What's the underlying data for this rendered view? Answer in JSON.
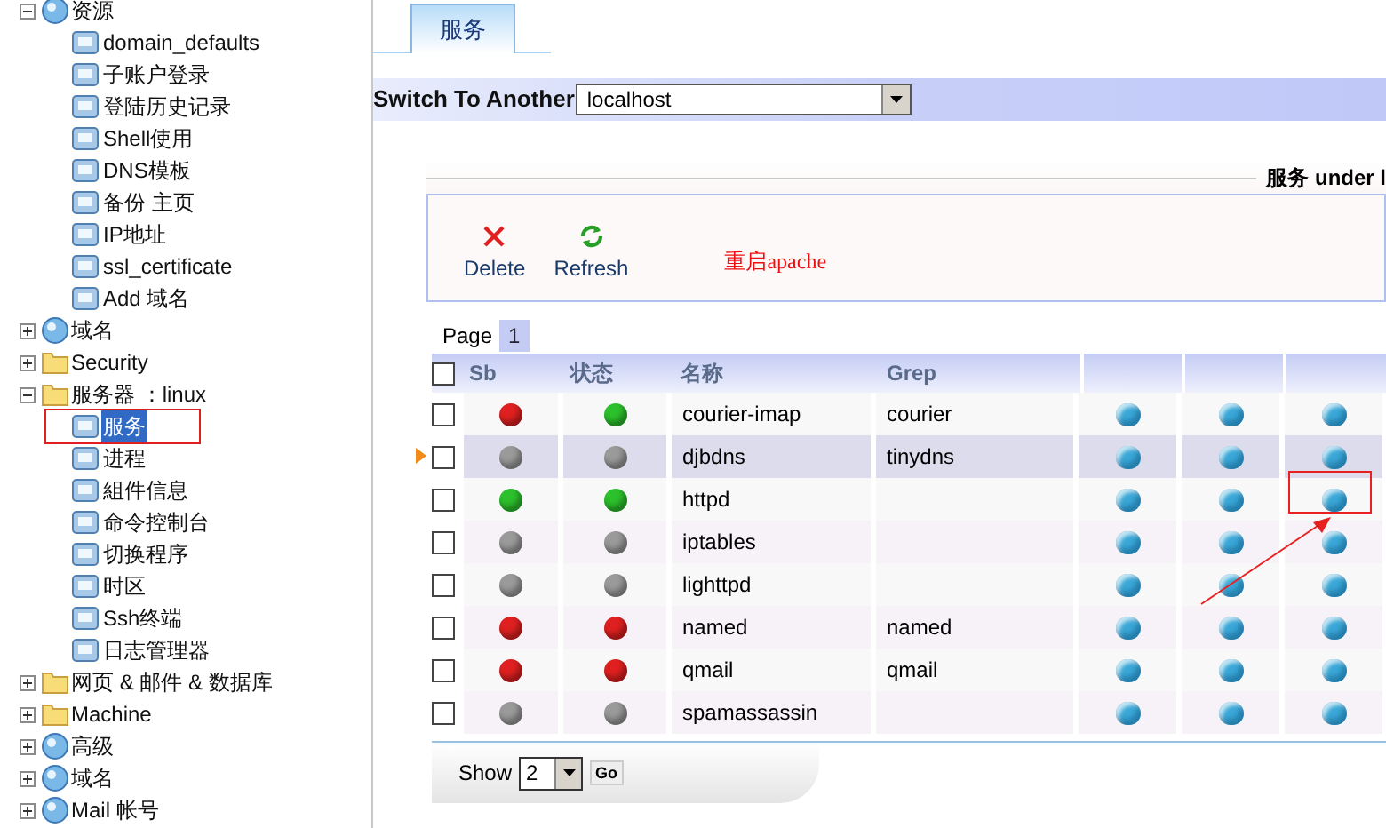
{
  "sidebar": {
    "items": [
      {
        "label": "资源",
        "kind": "item",
        "expanded": true,
        "children": [
          {
            "label": "domain_defaults",
            "selected": false,
            "highlighted": false
          },
          {
            "label": "子账户登录",
            "selected": false,
            "highlighted": false
          },
          {
            "label": "登陆历史记录",
            "selected": false,
            "highlighted": false
          },
          {
            "label": "Shell使用",
            "selected": false,
            "highlighted": false
          },
          {
            "label": "DNS模板",
            "selected": false,
            "highlighted": false
          },
          {
            "label": "备份 主页",
            "selected": false,
            "highlighted": false
          },
          {
            "label": "IP地址",
            "selected": false,
            "highlighted": false
          },
          {
            "label": "ssl_certificate",
            "selected": false,
            "highlighted": false
          },
          {
            "label": "Add 域名",
            "selected": false,
            "highlighted": false
          }
        ]
      },
      {
        "label": "域名",
        "kind": "item",
        "expanded": false
      },
      {
        "label": "Security",
        "kind": "folder",
        "expanded": false
      },
      {
        "label": "服务器 ：linux",
        "kind": "folder",
        "expanded": true,
        "children": [
          {
            "label": "服务",
            "selected": true,
            "highlighted": true
          },
          {
            "label": "进程",
            "selected": false,
            "highlighted": false
          },
          {
            "label": "組件信息",
            "selected": false,
            "highlighted": false
          },
          {
            "label": "命令控制台",
            "selected": false,
            "highlighted": false
          },
          {
            "label": "切换程序",
            "selected": false,
            "highlighted": false
          },
          {
            "label": "时区",
            "selected": false,
            "highlighted": false
          },
          {
            "label": "Ssh终端",
            "selected": false,
            "highlighted": false
          },
          {
            "label": "日志管理器",
            "selected": false,
            "highlighted": false
          }
        ]
      },
      {
        "label": "网页 & 邮件 & 数据库",
        "kind": "folder",
        "expanded": false
      },
      {
        "label": "Machine",
        "kind": "folder",
        "expanded": false
      },
      {
        "label": "高级",
        "kind": "item",
        "expanded": false
      },
      {
        "label": "域名",
        "kind": "item",
        "expanded": false
      },
      {
        "label": "Mail 帐号",
        "kind": "item",
        "expanded": false
      }
    ]
  },
  "tabs": [
    {
      "label": "服务",
      "selected": true
    }
  ],
  "switch": {
    "label": "Switch To Another",
    "value": "localhost"
  },
  "heading": "服务 under l",
  "toolbar": [
    {
      "kind": "delete",
      "label": "Delete"
    },
    {
      "kind": "refresh",
      "label": "Refresh"
    },
    {
      "kind": "text",
      "label": "重启apache"
    }
  ],
  "pager": {
    "label": "Page",
    "pages": [
      {
        "label": "1",
        "selected": true
      }
    ]
  },
  "table": {
    "select_all": {
      "checked": false
    },
    "columns": [
      "Sb",
      "状态",
      "名称",
      "Grep"
    ],
    "rows": [
      {
        "selected": false,
        "checked": false,
        "sb": {
          "color": "#e02020"
        },
        "state": {
          "color": "#2cc02c"
        },
        "name": "courier-imap",
        "grep": "courier",
        "actions": [
          {
            "marked": false
          },
          {
            "marked": false
          },
          {
            "marked": false
          }
        ]
      },
      {
        "selected": true,
        "checked": false,
        "sb": {
          "color": "#9a9a9a"
        },
        "state": {
          "color": "#9a9a9a"
        },
        "name": "djbdns",
        "grep": "tinydns",
        "actions": [
          {
            "marked": false
          },
          {
            "marked": false
          },
          {
            "marked": false
          }
        ]
      },
      {
        "selected": false,
        "checked": false,
        "sb": {
          "color": "#2cc02c"
        },
        "state": {
          "color": "#2cc02c"
        },
        "name": "httpd",
        "actions": [
          {
            "marked": false
          },
          {
            "marked": false
          },
          {
            "marked": true
          }
        ]
      },
      {
        "selected": false,
        "checked": false,
        "sb": {
          "color": "#9a9a9a"
        },
        "state": {
          "color": "#9a9a9a"
        },
        "name": "iptables",
        "actions": [
          {
            "marked": false
          },
          {
            "marked": false
          },
          {
            "marked": false
          }
        ]
      },
      {
        "selected": false,
        "checked": false,
        "sb": {
          "color": "#9a9a9a"
        },
        "state": {
          "color": "#9a9a9a"
        },
        "name": "lighttpd",
        "actions": [
          {
            "marked": false
          },
          {
            "marked": false
          },
          {
            "marked": false
          }
        ]
      },
      {
        "selected": false,
        "checked": false,
        "sb": {
          "color": "#e02020"
        },
        "state": {
          "color": "#e02020"
        },
        "name": "named",
        "grep": "named",
        "actions": [
          {
            "marked": false
          },
          {
            "marked": false
          },
          {
            "marked": false
          }
        ]
      },
      {
        "selected": false,
        "checked": false,
        "sb": {
          "color": "#e02020"
        },
        "state": {
          "color": "#e02020"
        },
        "name": "qmail",
        "grep": "qmail",
        "actions": [
          {
            "marked": false
          },
          {
            "marked": false
          },
          {
            "marked": false
          }
        ]
      },
      {
        "selected": false,
        "checked": false,
        "sb": {
          "color": "#9a9a9a"
        },
        "state": {
          "color": "#9a9a9a"
        },
        "name": "spamassassin",
        "actions": [
          {
            "marked": false
          },
          {
            "marked": false
          },
          {
            "marked": false
          }
        ]
      }
    ]
  },
  "footer": {
    "label": "Show",
    "value": "2",
    "button": "Go"
  }
}
